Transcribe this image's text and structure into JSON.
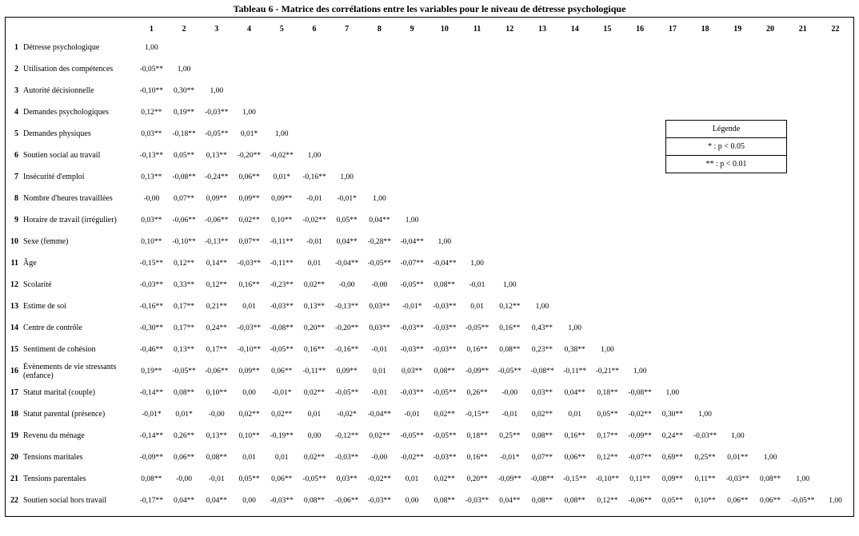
{
  "title": "Tableau 6 - Matrice des corrélations entre les variables pour le niveau de détresse psychologique",
  "legend": {
    "header": "Légende",
    "row1": "* :  p < 0.05",
    "row2": "** :  p < 0.01"
  },
  "col_headers": [
    "1",
    "2",
    "3",
    "4",
    "5",
    "6",
    "7",
    "8",
    "9",
    "10",
    "11",
    "12",
    "13",
    "14",
    "15",
    "16",
    "17",
    "18",
    "19",
    "20",
    "21",
    "22"
  ],
  "rows": [
    {
      "num": "1",
      "label": "Détresse psychologique",
      "v": [
        "1,00"
      ]
    },
    {
      "num": "2",
      "label": "Utilisation des compétences",
      "v": [
        "-0,05**",
        "1,00"
      ]
    },
    {
      "num": "3",
      "label": "Autorité décisionnelle",
      "v": [
        "-0,10**",
        "0,30**",
        "1,00"
      ]
    },
    {
      "num": "4",
      "label": "Demandes psychologiques",
      "v": [
        "0,12**",
        "0,19**",
        "-0,03**",
        "1,00"
      ]
    },
    {
      "num": "5",
      "label": "Demandes physiques",
      "v": [
        "0,03**",
        "-0,18**",
        "-0,05**",
        "0,01*",
        "1,00"
      ]
    },
    {
      "num": "6",
      "label": "Soutien social au travail",
      "v": [
        "-0,13**",
        "0,05**",
        "0,13**",
        "-0,20**",
        "-0,02**",
        "1,00"
      ]
    },
    {
      "num": "7",
      "label": "Insécurité d'emploi",
      "v": [
        "0,13**",
        "-0,08**",
        "-0,24**",
        "0,06**",
        "0,01*",
        "-0,16**",
        "1,00"
      ]
    },
    {
      "num": "8",
      "label": "Nombre d'heures travaillées",
      "v": [
        "-0,00",
        "0,07**",
        "0,09**",
        "0,09**",
        "0,09**",
        "-0,01",
        "-0,01*",
        "1,00"
      ]
    },
    {
      "num": "9",
      "label": "Horaire de travail (irrégulier)",
      "v": [
        "0,03**",
        "-0,06**",
        "-0,06**",
        "0,02**",
        "0,10**",
        "-0,02**",
        "0,05**",
        "0,04**",
        "1,00"
      ]
    },
    {
      "num": "10",
      "label": "Sexe (femme)",
      "v": [
        "0,10**",
        "-0,10**",
        "-0,13**",
        "0,07**",
        "-0,11**",
        "-0,01",
        "0,04**",
        "-0,28**",
        "-0,04**",
        "1,00"
      ]
    },
    {
      "num": "11",
      "label": "Âge",
      "v": [
        "-0,15**",
        "0,12**",
        "0,14**",
        "-0,03**",
        "-0,11**",
        "0,01",
        "-0,04**",
        "-0,05**",
        "-0,07**",
        "-0,04**",
        "1,00"
      ]
    },
    {
      "num": "12",
      "label": "Scolarité",
      "v": [
        "-0,03**",
        "0,33**",
        "0,12**",
        "0,16**",
        "-0,23**",
        "0,02**",
        "-0,00",
        "-0,00",
        "-0,05**",
        "0,08**",
        "-0,01",
        "1,00"
      ]
    },
    {
      "num": "13",
      "label": "Estime de soi",
      "v": [
        "-0,16**",
        "0,17**",
        "0,21**",
        "0,01",
        "-0,03**",
        "0,13**",
        "-0,13**",
        "0,03**",
        "-0,01*",
        "-0,03**",
        "0,01",
        "0,12**",
        "1,00"
      ]
    },
    {
      "num": "14",
      "label": "Centre de contrôle",
      "v": [
        "-0,30**",
        "0,17**",
        "0,24**",
        "-0,03**",
        "-0,08**",
        "0,20**",
        "-0,20**",
        "0,03**",
        "-0,03**",
        "-0,03**",
        "-0,05**",
        "0,16**",
        "0,43**",
        "1,00"
      ]
    },
    {
      "num": "15",
      "label": "Sentiment de cohésion",
      "v": [
        "-0,46**",
        "0,13**",
        "0,17**",
        "-0,10**",
        "-0,05**",
        "0,16**",
        "-0,16**",
        "-0,01",
        "-0,03**",
        "-0,03**",
        "0,16**",
        "0,08**",
        "0,23**",
        "0,38**",
        "1,00"
      ]
    },
    {
      "num": "16",
      "label": "Évènements de vie stressants (enfance)",
      "v": [
        "0,19**",
        "-0,05**",
        "-0,06**",
        "0,09**",
        "0,06**",
        "-0,11**",
        "0,09**",
        "0,01",
        "0,03**",
        "0,08**",
        "-0,09**",
        "-0,05**",
        "-0,08**",
        "-0,11**",
        "-0,21**",
        "1,00"
      ]
    },
    {
      "num": "17",
      "label": "Statut marital (couple)",
      "v": [
        "-0,14**",
        "0,08**",
        "0,10**",
        "0,00",
        "-0,01*",
        "0,02**",
        "-0,05**",
        "-0,01",
        "-0,03**",
        "-0,05**",
        "0,26**",
        "-0,00",
        "0,03**",
        "0,04**",
        "0,18**",
        "-0,08**",
        "1,00"
      ]
    },
    {
      "num": "18",
      "label": "Statut parental (présence)",
      "v": [
        "-0,01*",
        "0,01*",
        "-0,00",
        "0,02**",
        "0,02**",
        "0,01",
        "-0,02*",
        "-0,04**",
        "-0,01",
        "0,02**",
        "-0,15**",
        "-0,01",
        "0,02**",
        "0,01",
        "0,05**",
        "-0,02**",
        "0,30**",
        "1,00"
      ]
    },
    {
      "num": "19",
      "label": "Revenu du ménage",
      "v": [
        "-0,14**",
        "0,26**",
        "0,13**",
        "0,10**",
        "-0,19**",
        "0,00",
        "-0,12**",
        "0,02**",
        "-0,05**",
        "-0,05**",
        "0,18**",
        "0,25**",
        "0,08**",
        "0,16**",
        "0,17**",
        "-0,09**",
        "0,24**",
        "-0,03**",
        "1,00"
      ]
    },
    {
      "num": "20",
      "label": "Tensions maritales",
      "v": [
        "-0,09**",
        "0,06**",
        "0,08**",
        "0,01",
        "0,01",
        "0,02**",
        "-0,03**",
        "-0,00",
        "-0,02**",
        "-0,03**",
        "0,16**",
        "-0,01*",
        "0,07**",
        "0,06**",
        "0,12**",
        "-0,07**",
        "0,69**",
        "0,25**",
        "0,01**",
        "1,00"
      ]
    },
    {
      "num": "21",
      "label": "Tensions parentales",
      "v": [
        "0,08**",
        "-0,00",
        "-0,01",
        "0,05**",
        "0,06**",
        "-0,05**",
        "0,03**",
        "-0,02**",
        "0,01",
        "0,02**",
        "0,20**",
        "-0,09**",
        "-0,08**",
        "-0,15**",
        "-0,10**",
        "0,11**",
        "0,09**",
        "0,11**",
        "-0,03**",
        "0,08**",
        "1,00"
      ]
    },
    {
      "num": "22",
      "label": "Soutien social hors travail",
      "v": [
        "-0,17**",
        "0,04**",
        "0,04**",
        "0,00",
        "-0,03**",
        "0,08**",
        "-0,06**",
        "-0,03**",
        "0,00",
        "0,08**",
        "-0,03**",
        "0,04**",
        "0,08**",
        "0,08**",
        "0,12**",
        "-0,06**",
        "0,05**",
        "0,10**",
        "0,06**",
        "0,06**",
        "-0,05**",
        "1,00"
      ]
    }
  ]
}
